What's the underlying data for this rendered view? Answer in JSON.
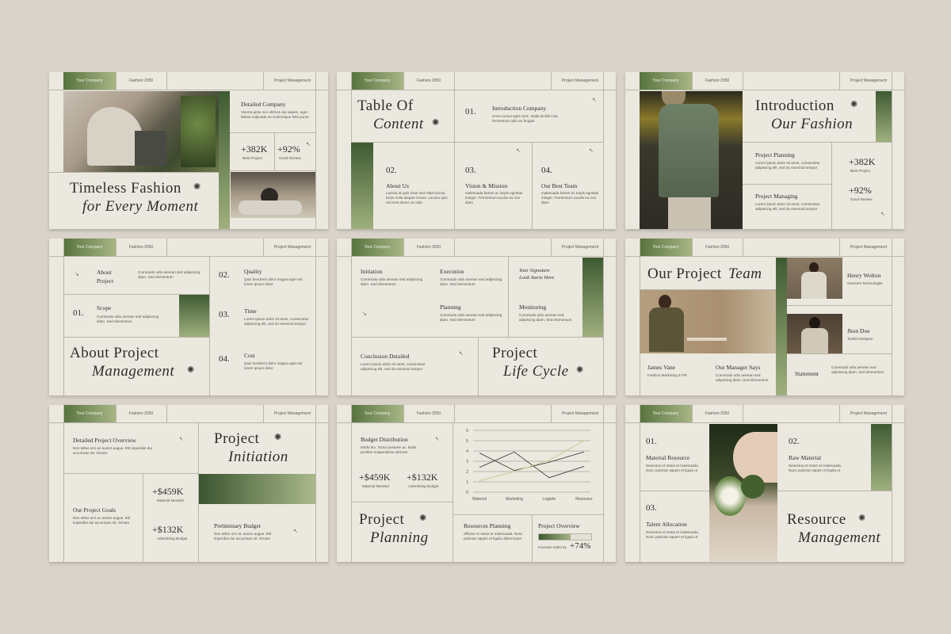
{
  "common": {
    "company": "Your Company",
    "fashion": "Fashion 2050",
    "project_mgmt": "Project Management",
    "lorem_a": "Viverra justo nec ultrices dui sapien, eget. Metus vulputate eu scelerisque felis purus",
    "lorem_b": "Commodo odio aenean sed adipiscing diam. Sed elementum",
    "lorem_c": "Lorem ipsum dolor sit amet, consectetur adipiscing elit, sed do eiusmod tempor",
    "lorem_d": "Quis hendrerit dolor magna eget est lorem ipsum dolor",
    "lorem_e": "Non tellus orci ac auctor augue. Elit imperdiet dui accumsan sit. Ornare",
    "lorem_f": "Senectus et netus et malesuada. Nunc pulvinar sapien et ligula ut",
    "arrow": "↘",
    "arrow_ul": "↖",
    "star": "✺"
  },
  "s1": {
    "detailed": "Detailed Company",
    "desc": "Viverra justo nec ultrices dui sapien, eget. Metus vulputate eu scelerisque felis purus",
    "stat1": "+382K",
    "stat1_label": "Best Project",
    "stat2": "+92%",
    "stat2_label": "Good Review",
    "title1": "Timeless Fashion",
    "title2": "for Every Moment"
  },
  "s2": {
    "title1": "Table Of",
    "title2": "Content",
    "n1": "01.",
    "i1": "Introduction Company",
    "d1": "Urna cursus eget nunc. Nulla facilisi cras fermentum odio eu feugiat",
    "n2": "02.",
    "i2": "About Us",
    "d2": "Lacinia at quis risus sed vitae lacinia. Enim nulla aliquet ornare. Lacinia quis vel eros donec ac odio",
    "n3": "03.",
    "i3": "Vision & Mission",
    "d3": "malesuada fames ac turpis egestas integer. Fermentum iaculis eu non diam",
    "n4": "04.",
    "i4": "Our Best Team",
    "d4": "malesuada fames ac turpis egestas integer. Fermentum iaculis eu non diam"
  },
  "s3": {
    "title1": "Introduction",
    "title2": "Our Fashion",
    "p1": "Project Planning",
    "d1": "Lorem ipsum dolor sit amet, consectetur adipiscing elit, sed do eiusmod tempor",
    "p2": "Project Managing",
    "d2": "Lorem ipsum dolor sit amet, consectetur adipiscing elit, sed do eiusmod tempor",
    "stat1": "+382K",
    "stat1_label": "Best Project",
    "stat2": "+92%",
    "stat2_label": "Good Review"
  },
  "s4": {
    "about1": "About",
    "about2": "Project",
    "n1": "01.",
    "scope": "Scope",
    "n2": "02.",
    "quality": "Quality",
    "n3": "03.",
    "time": "Time",
    "n4": "04.",
    "cost": "Cost",
    "title1": "About Project",
    "title2": "Management"
  },
  "s5": {
    "initiation": "Initiation",
    "execution": "Execution",
    "planning": "Planning",
    "monitoring": "Monitoring",
    "signature1": "Your Signature",
    "signature2": "Look Starts Here",
    "conclusion": "Conclusion Detailed",
    "title1": "Project",
    "title2": "Life Cycle"
  },
  "s6": {
    "title1": "Our Project",
    "title2": "Team",
    "m1": "Henry Wolton",
    "r1": "Garment Technologist",
    "m2": "Jhon Doe",
    "r2": "Textile Designer",
    "m3": "James Vane",
    "r3": "Fashion Marketing & PR",
    "m4": "Our Manager Says",
    "statement": "Statement"
  },
  "s7": {
    "overview": "Detailed Project Overview",
    "goals": "Our Project Goals",
    "v1": "+$459K",
    "v1_label": "Material Needed",
    "v2": "+$132K",
    "v2_label": "Advertising Budget",
    "title1": "Project",
    "title2": "Initiation",
    "prelim": "Preliminary Budget"
  },
  "s8": {
    "budget": "Budget Distribution",
    "budget_desc": "Morbi leo. Tortor posuere ac. Nulla porttitor suspendisse ultricies",
    "v1": "+$459K",
    "v1_label": "Material Needed",
    "v2": "+$132K",
    "v2_label": "Advertising Budget",
    "title1": "Project",
    "title2": "Planning",
    "res_plan": "Resources Planning",
    "res_desc": "efficitur et netus et malesuada. Nunc pulvinar sapien et ligula ullamcorper",
    "overview": "Project Overview",
    "increase": "Increase sales by",
    "increase_val": "+74%"
  },
  "s9": {
    "n1": "01.",
    "mat_res": "Material Resource",
    "n2": "02.",
    "raw": "Raw Material",
    "n3": "03.",
    "talent": "Talent Allocation",
    "title1": "Resource",
    "title2": "Management"
  },
  "chart_data": {
    "type": "line",
    "categories": [
      "Material",
      "Marketing",
      "Logistic",
      "Resource"
    ],
    "ylim": [
      0,
      6
    ],
    "yticks": [
      0,
      1,
      2,
      3,
      4,
      5,
      6
    ],
    "series": [
      {
        "values": [
          3.8,
          2.1,
          2.9,
          3.9
        ],
        "color": "#2e2e28"
      },
      {
        "values": [
          2.4,
          3.9,
          1.4,
          2.5
        ],
        "color": "#2e2e28"
      },
      {
        "values": [
          1.1,
          2.0,
          3.1,
          5.0
        ],
        "color": "#c9cf9e"
      }
    ]
  }
}
